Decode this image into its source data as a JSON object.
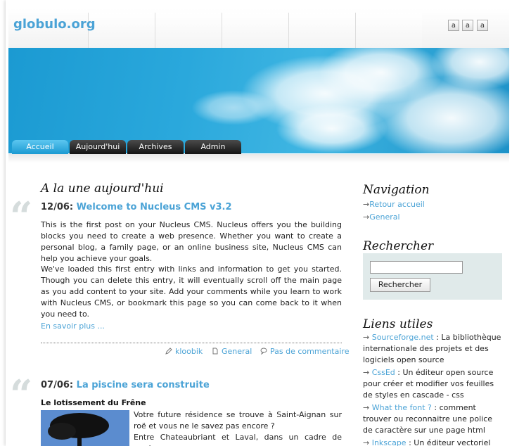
{
  "site": {
    "logo": "globulo.org"
  },
  "font_sizes": [
    "a",
    "a",
    "a"
  ],
  "nav_tabs": [
    "Accueil",
    "Aujourd'hui",
    "Archives",
    "Admin"
  ],
  "main": {
    "section_title": "A la une aujourd'hui",
    "post1": {
      "date": "12/06:",
      "title": "Welcome to Nucleus CMS v3.2",
      "para1": "This is the first post on your Nucleus CMS. Nucleus offers you the building blocks you need to create a web presence. Whether you want to create a personal blog, a family page, or an online business site, Nucleus CMS can help you achieve your goals.",
      "para2": "We've loaded this first entry with links and information to get you started. Though you can delete this entry, it will eventually scroll off the main page as you add content to your site. Add your comments while you learn to work with Nucleus CMS, or bookmark this page so you can come back to it when you need to.",
      "more": "En savoir plus ...",
      "author": "kloobik",
      "category": "General",
      "comments": "Pas de commentaire"
    },
    "post2": {
      "date": "07/06:",
      "title": "La piscine sera construite",
      "subtitle": "Le lotissement du Frêne",
      "para1": "Votre future résidence se trouve à Saint-Aignan sur roë et vous ne le savez pas encore ?",
      "para2": "Entre Chateaubriant et Laval, dans un cadre de verdure"
    }
  },
  "sidebar": {
    "nav_title": "Navigation",
    "nav_items": [
      "Retour accueil",
      "General"
    ],
    "search_title": "Rechercher",
    "search_button": "Rechercher",
    "search_value": "",
    "links_title": "Liens utiles",
    "links": [
      {
        "name": "Sourceforge.net",
        "desc": " : La bibliothèque internationale des projets et des logiciels open source"
      },
      {
        "name": "CssEd",
        "desc": " : Un éditeur open source pour créer et modifier vos feuilles de styles en cascade - css"
      },
      {
        "name": "What the font ?",
        "desc": " : comment trouver ou reconnaitre une police de caractère sur une page html"
      },
      {
        "name": "Inkscape",
        "desc": " : Un éditeur vectoriel"
      }
    ]
  },
  "colors": {
    "accent": "#4ba3d6",
    "tab_active": "#1b9ad2",
    "tab_dark": "#141414"
  }
}
